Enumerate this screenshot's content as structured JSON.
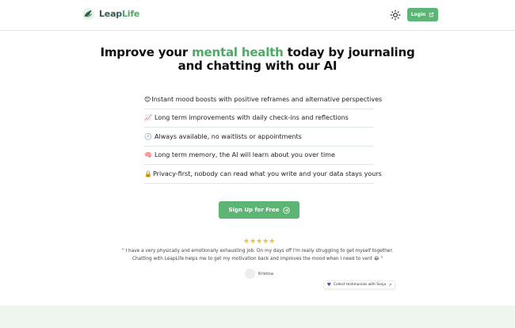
{
  "header": {
    "brand_prefix": "Leap",
    "brand_suffix": "Life",
    "login_label": "Login"
  },
  "hero": {
    "headline_pre": "Improve your ",
    "headline_highlight": "mental health",
    "headline_post": " today by journaling",
    "headline_line2": "and chatting with our AI"
  },
  "features": [
    {
      "emoji": "😊",
      "text": "Instant mood boosts with positive reframes and alternative perspectives"
    },
    {
      "emoji": "📈",
      "text": "Long term improvements with daily check-ins and reflections"
    },
    {
      "emoji": "🕐",
      "text": "Always available, no waitlists or appointments"
    },
    {
      "emoji": "🧠",
      "text": "Long term memory, the AI will learn about you over time"
    },
    {
      "emoji": "🔒",
      "text": "Privacy-first, nobody can read what you write and your data stays yours"
    }
  ],
  "cta": {
    "label": "Sign Up for Free"
  },
  "testimonial": {
    "stars": "★★★★★",
    "quote_line1": "\" I have a very physically and emotionally exhausting job. On my days off I'm really struggling to get myself together.",
    "quote_line2": "Chatting with LeapLife helps me to get my motivation back and improves the mood when I need to vent 😂 \"",
    "author": "Kristina",
    "senja_label": "Collect testimonials with Senja"
  },
  "colors": {
    "accent": "#5cb574",
    "highlight": "#4fa865",
    "brand_dark": "#355d4e",
    "footer_bg": "#eff6f0"
  },
  "icons": {
    "logo": "leap-life-logo",
    "theme": "sun-icon",
    "login": "external-link-icon",
    "cta": "arrow-circle-right-icon",
    "senja": "heart-icon"
  }
}
